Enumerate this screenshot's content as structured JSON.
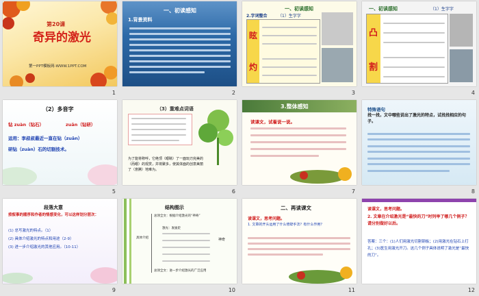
{
  "slides": [
    {
      "number": "1",
      "title": "奇异的激光",
      "lesson": "第20课",
      "footer": "第一PPT模板网-WWW.1PPT.COM"
    },
    {
      "number": "2",
      "heading": "一、初读感知",
      "sub": "1.背景资料"
    },
    {
      "number": "3",
      "heading": "一、初读感知",
      "sub": "2.字词整合",
      "sub2": "（1）生字字",
      "big1": "眩",
      "big2": "灼"
    },
    {
      "number": "4",
      "heading": "一、初读感知",
      "sub": "（1）生字字",
      "big1": "凸",
      "big2": "割"
    },
    {
      "number": "5",
      "title": "（2）多音字",
      "line1a": "钻 zuàn（钻石）",
      "line1b": "zuān（钻研）",
      "line2": "运用：李叔叔最近一直在钻（zuān）",
      "line3": "研钻（zuàn）石的切割技术。"
    },
    {
      "number": "6",
      "title": "（3）重难点词语",
      "body": "为了能将称呼，它绝顶（眼睛）了一面玩刃完美的（而眼）的观赏，并将聚多，使其体面的创意美丽了（意腾）地难为。"
    },
    {
      "number": "7",
      "title": "3.整体感知",
      "prompt": "读课文，试着说一说。"
    },
    {
      "number": "8",
      "title": "特殊语句",
      "intro": "找一找，文中哪些说出了激光的特点，试找找相应的句子。"
    },
    {
      "number": "9",
      "title": "段落大意",
      "prompt": "按叙事的顺序和作者的情感变化，可以这样划分层次：",
      "items": [
        "(1) 总写激光的特点。（1）",
        "(2) 具体介绍激光的特点和用途（2-9）",
        "(3) 进一步介绍激光的其他应用。（10-11）"
      ]
    },
    {
      "number": "10",
      "title": "结构图示",
      "rows": [
        "总领全文：根据介绍激光的“神奇”",
        "具体介绍",
        "激光：发展史",
        "总领全文：进一步介绍激光的广泛应用"
      ],
      "side": "神奇"
    },
    {
      "number": "11",
      "title": "二、再读课文",
      "prompt": "读课文，思考问题。",
      "q": "1. 文章的开头运用了什么修辞手法？有什么作用？"
    },
    {
      "number": "12",
      "prompt": "读课文，思考问题。",
      "q": "2. 文章在介绍激光是“最快的刀”时列举了哪几个例子？请分别做好以后。",
      "a": "答案：三个：(1)人们用激光切割钢板；(2)用激光在钻石上打孔；(3)医生用激光开刀。这几个例子具体说明了激光是“最快的刀”。"
    }
  ]
}
